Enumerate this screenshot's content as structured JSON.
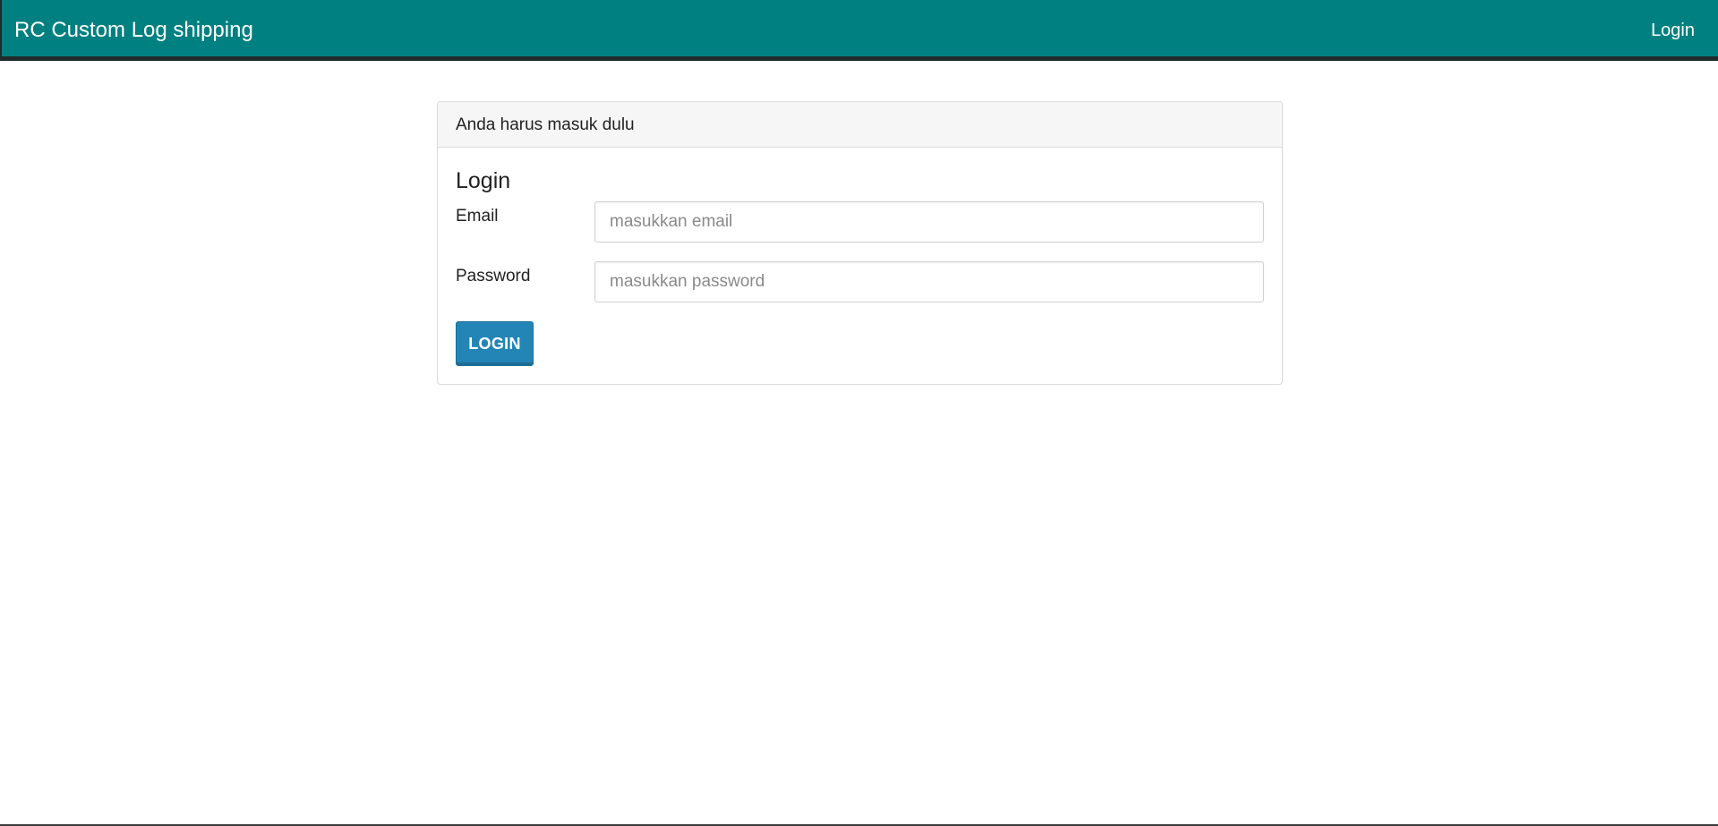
{
  "navbar": {
    "brand": "RC Custom Log shipping",
    "login_link": "Login"
  },
  "panel": {
    "heading": "Anda harus masuk dulu",
    "title": "Login",
    "email_label": "Email",
    "email_placeholder": "masukkan email",
    "email_value": "",
    "password_label": "Password",
    "password_placeholder": "masukkan password",
    "password_value": "",
    "submit_label": "LOGIN"
  },
  "colors": {
    "navbar": "#008080",
    "button": "#2385b5"
  }
}
